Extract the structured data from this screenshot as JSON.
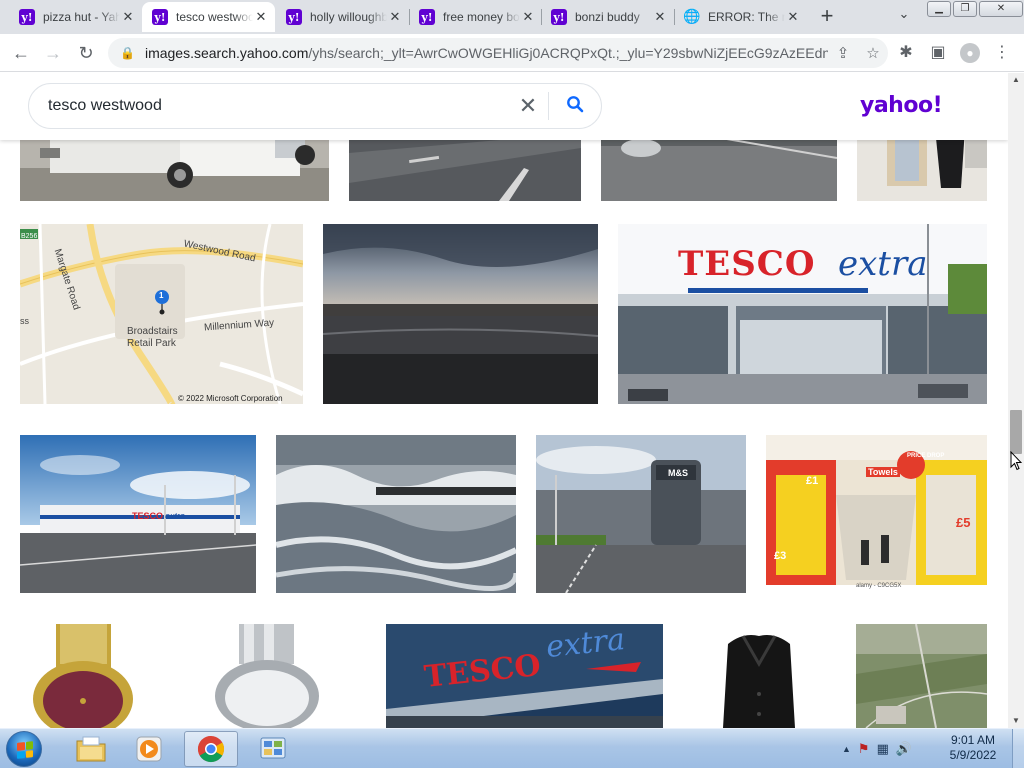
{
  "browser": {
    "tabs": [
      {
        "title": "pizza hut - Yahoo",
        "favicon": "yahoo-y",
        "active": false
      },
      {
        "title": "tesco westwood",
        "favicon": "yahoo-y",
        "active": true
      },
      {
        "title": "holly willoughby",
        "favicon": "yahoo-y",
        "active": false
      },
      {
        "title": "free money bonzi",
        "favicon": "yahoo-y",
        "active": false
      },
      {
        "title": "bonzi buddy",
        "favicon": "yahoo-y",
        "active": false
      },
      {
        "title": "ERROR: The request",
        "favicon": "globe",
        "active": false
      }
    ],
    "favicon_letter": "y!",
    "close_glyph": "✕",
    "new_tab": "+",
    "tab_search": "⌄",
    "window_buttons": {
      "minimize": "▁",
      "maximize": "❐",
      "close": "✕"
    },
    "nav": {
      "back": "←",
      "forward": "→",
      "reload": "↻"
    },
    "url": {
      "host": "images.search.yahoo.com",
      "path": "/yhs/search;_ylt=AwrCwOWGEHliGj0ACRQPxQt.;_ylu=Y29sbwNiZjEEcG9zAzEEdnR..."
    },
    "lock": "🔒",
    "share": "⇪",
    "bookmark": "☆",
    "extensions": "✱",
    "sidepanel": "▣",
    "profile": "●",
    "menu": "⋮"
  },
  "search": {
    "query": "tesco westwood",
    "clear": "✕",
    "submit": "⚲",
    "logo": "yahoo!"
  },
  "results": [
    {
      "name": "trailer-truck",
      "alt": "White pickup truck with trailer"
    },
    {
      "name": "road-aerial",
      "alt": "Road with lane markings"
    },
    {
      "name": "car-park",
      "alt": "Car park with car"
    },
    {
      "name": "store-interior",
      "alt": "Person in store"
    },
    {
      "name": "map",
      "alt": "Map of Westwood Road, Broadstairs Retail Park",
      "labels": {
        "road1": "Westwood Road",
        "road2": "Margate Road",
        "park": "Broadstairs",
        "park2": "Retail Park",
        "way": "Millennium Way",
        "marker": "1",
        "copyright": "© 2022 Microsoft Corporation",
        "route": "B256",
        "fragment": "ss"
      }
    },
    {
      "name": "harbour-sunset",
      "alt": "Harbour under cloudy sky"
    },
    {
      "name": "tesco-extra-store",
      "alt": "Tesco Extra store front",
      "sign": {
        "brand": "TESCO",
        "suffix": "extra"
      }
    },
    {
      "name": "tesco-exterior-wide",
      "alt": "Tesco store exterior and car park",
      "sign": {
        "brand": "TESCO",
        "suffix": "extra"
      }
    },
    {
      "name": "stormy-sea",
      "alt": "Waves crashing over groyne"
    },
    {
      "name": "ms-building",
      "alt": "M&S building at retail park",
      "sign": {
        "brand": "M&S"
      }
    },
    {
      "name": "supermarket-aisle",
      "alt": "Supermarket aisle with price signs",
      "signs": {
        "towels": "Towels",
        "price1": "£5",
        "price2": "£3",
        "price3": "£1",
        "badge": "PRICE DROP",
        "caption": "alamy - C9CG5X"
      }
    },
    {
      "name": "watch-gold",
      "alt": "Gold watch with burgundy face"
    },
    {
      "name": "watch-silver",
      "alt": "Silver watch"
    },
    {
      "name": "tesco-extra-sign",
      "alt": "Tesco Extra sign",
      "sign": {
        "brand": "TESCO",
        "suffix": "extra"
      }
    },
    {
      "name": "black-jacket",
      "alt": "Black jacket"
    },
    {
      "name": "aerial-fields",
      "alt": "Aerial view of fields"
    }
  ],
  "scrollbar": {
    "up": "▲",
    "down": "▼"
  },
  "taskbar": {
    "items": [
      {
        "name": "ie",
        "active": false
      },
      {
        "name": "explorer",
        "active": false
      },
      {
        "name": "media-player",
        "active": false
      },
      {
        "name": "chrome",
        "active": true
      },
      {
        "name": "control-panel",
        "active": false
      }
    ],
    "tray": {
      "arrow": "▲",
      "flag": "⚑",
      "network": "▦",
      "volume": "🔊"
    },
    "time": "9:01 AM",
    "date": "5/9/2022"
  }
}
